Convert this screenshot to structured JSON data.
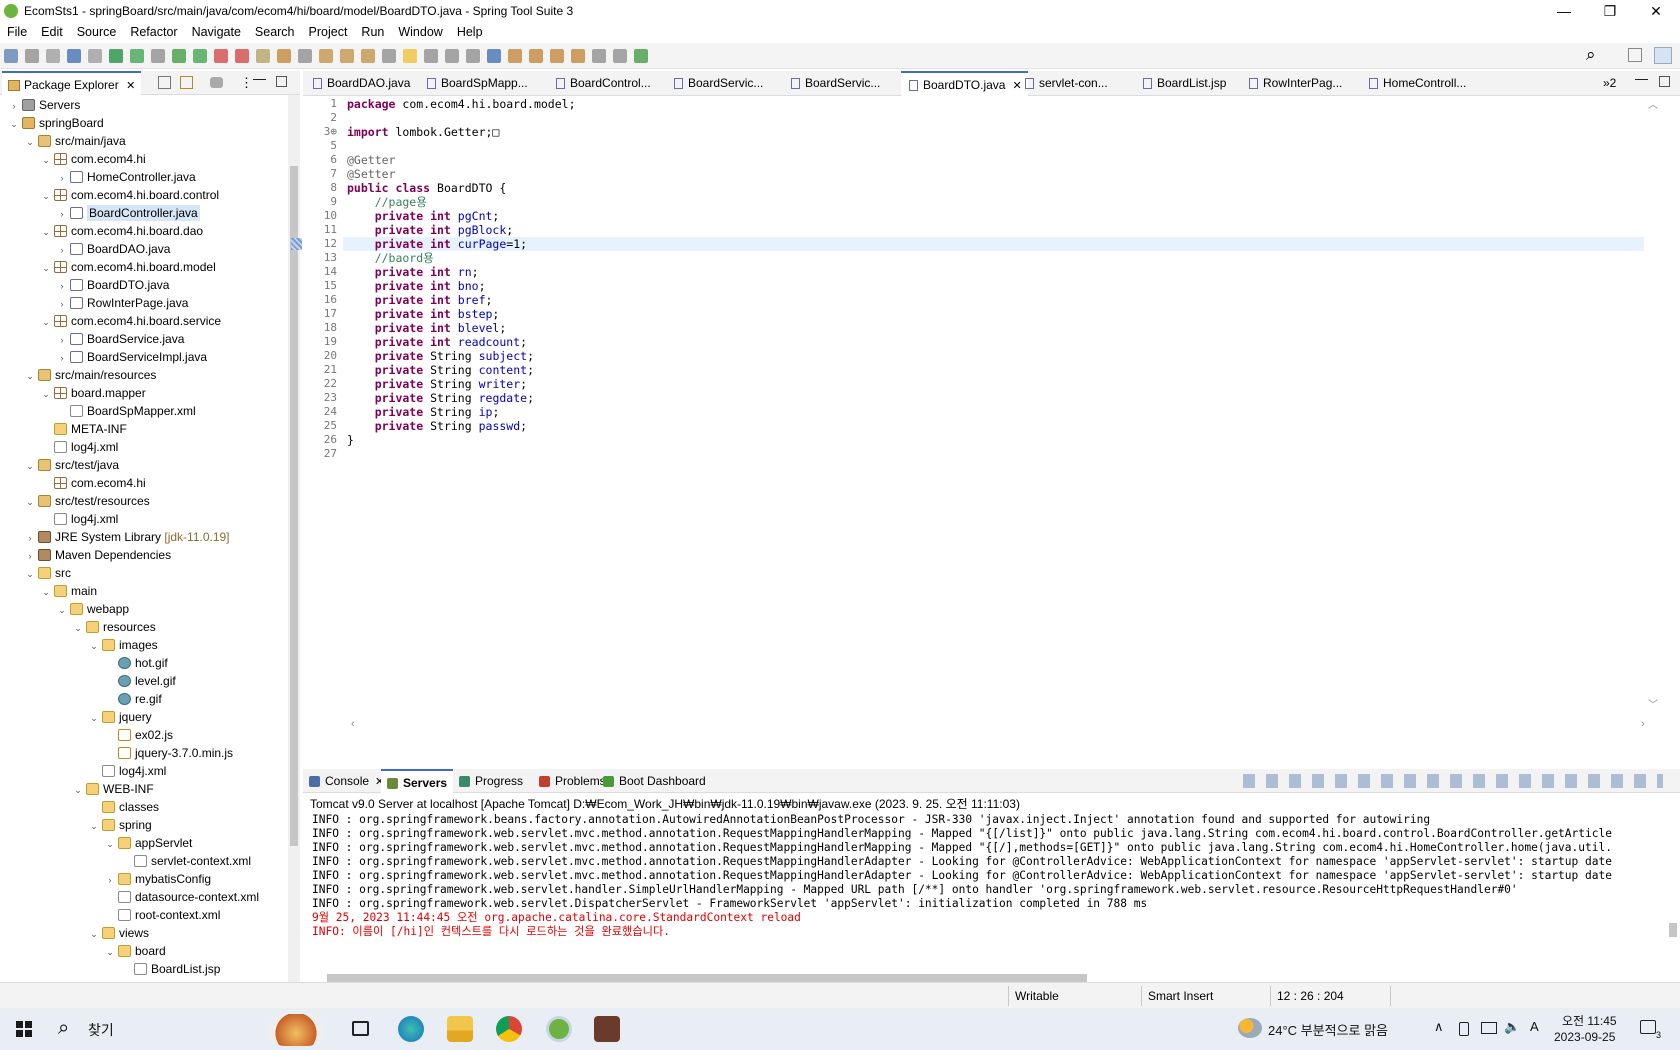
{
  "window": {
    "title": "EcomSts1 - springBoard/src/main/java/com/ecom4/hi/board/model/BoardDTO.java - Spring Tool Suite 3",
    "min_glyph": "—",
    "max_glyph": "❐",
    "close_glyph": "✕"
  },
  "menu": [
    "File",
    "Edit",
    "Source",
    "Refactor",
    "Navigate",
    "Search",
    "Project",
    "Run",
    "Window",
    "Help"
  ],
  "package_explorer": {
    "tab_label": "Package Explorer",
    "close_glyph": "✕",
    "tree": [
      {
        "label": "Servers",
        "level": 0,
        "twisty": "›",
        "icon": "srv"
      },
      {
        "label": "springBoard",
        "level": 0,
        "twisty": "⌄",
        "icon": "proj"
      },
      {
        "label": "src/main/java",
        "level": 1,
        "twisty": "⌄",
        "icon": "src"
      },
      {
        "label": "com.ecom4.hi",
        "level": 2,
        "twisty": "⌄",
        "icon": "pkg"
      },
      {
        "label": "HomeController.java",
        "level": 3,
        "twisty": "›",
        "icon": "java"
      },
      {
        "label": "com.ecom4.hi.board.control",
        "level": 2,
        "twisty": "⌄",
        "icon": "pkg"
      },
      {
        "label": "BoardController.java",
        "level": 3,
        "twisty": "›",
        "icon": "java",
        "selected": true
      },
      {
        "label": "com.ecom4.hi.board.dao",
        "level": 2,
        "twisty": "⌄",
        "icon": "pkg"
      },
      {
        "label": "BoardDAO.java",
        "level": 3,
        "twisty": "›",
        "icon": "java"
      },
      {
        "label": "com.ecom4.hi.board.model",
        "level": 2,
        "twisty": "⌄",
        "icon": "pkg"
      },
      {
        "label": "BoardDTO.java",
        "level": 3,
        "twisty": "›",
        "icon": "java"
      },
      {
        "label": "RowInterPage.java",
        "level": 3,
        "twisty": "›",
        "icon": "java"
      },
      {
        "label": "com.ecom4.hi.board.service",
        "level": 2,
        "twisty": "⌄",
        "icon": "pkg"
      },
      {
        "label": "BoardService.java",
        "level": 3,
        "twisty": "›",
        "icon": "java"
      },
      {
        "label": "BoardServiceImpl.java",
        "level": 3,
        "twisty": "›",
        "icon": "java"
      },
      {
        "label": "src/main/resources",
        "level": 1,
        "twisty": "⌄",
        "icon": "src"
      },
      {
        "label": "board.mapper",
        "level": 2,
        "twisty": "⌄",
        "icon": "pkg"
      },
      {
        "label": "BoardSpMapper.xml",
        "level": 3,
        "twisty": "",
        "icon": "xml"
      },
      {
        "label": "META-INF",
        "level": 2,
        "twisty": "",
        "icon": "fold"
      },
      {
        "label": "log4j.xml",
        "level": 2,
        "twisty": "",
        "icon": "xml"
      },
      {
        "label": "src/test/java",
        "level": 1,
        "twisty": "⌄",
        "icon": "src"
      },
      {
        "label": "com.ecom4.hi",
        "level": 2,
        "twisty": "",
        "icon": "pkg"
      },
      {
        "label": "src/test/resources",
        "level": 1,
        "twisty": "⌄",
        "icon": "src"
      },
      {
        "label": "log4j.xml",
        "level": 2,
        "twisty": "",
        "icon": "xml"
      },
      {
        "label": "JRE System Library",
        "suffix": "[jdk-11.0.19]",
        "level": 1,
        "twisty": "›",
        "icon": "lib"
      },
      {
        "label": "Maven Dependencies",
        "level": 1,
        "twisty": "›",
        "icon": "lib"
      },
      {
        "label": "src",
        "level": 1,
        "twisty": "⌄",
        "icon": "fold"
      },
      {
        "label": "main",
        "level": 2,
        "twisty": "⌄",
        "icon": "fold"
      },
      {
        "label": "webapp",
        "level": 3,
        "twisty": "⌄",
        "icon": "fold"
      },
      {
        "label": "resources",
        "level": 4,
        "twisty": "⌄",
        "icon": "fold"
      },
      {
        "label": "images",
        "level": 5,
        "twisty": "⌄",
        "icon": "fold"
      },
      {
        "label": "hot.gif",
        "level": 6,
        "twisty": "",
        "icon": "gif"
      },
      {
        "label": "level.gif",
        "level": 6,
        "twisty": "",
        "icon": "gif"
      },
      {
        "label": "re.gif",
        "level": 6,
        "twisty": "",
        "icon": "gif"
      },
      {
        "label": "jquery",
        "level": 5,
        "twisty": "⌄",
        "icon": "fold"
      },
      {
        "label": "ex02.js",
        "level": 6,
        "twisty": "",
        "icon": "js"
      },
      {
        "label": "jquery-3.7.0.min.js",
        "level": 6,
        "twisty": "",
        "icon": "js"
      },
      {
        "label": "log4j.xml",
        "level": 5,
        "twisty": "",
        "icon": "xml"
      },
      {
        "label": "WEB-INF",
        "level": 4,
        "twisty": "⌄",
        "icon": "fold"
      },
      {
        "label": "classes",
        "level": 5,
        "twisty": "",
        "icon": "fold"
      },
      {
        "label": "spring",
        "level": 5,
        "twisty": "⌄",
        "icon": "fold"
      },
      {
        "label": "appServlet",
        "level": 6,
        "twisty": "⌄",
        "icon": "fold"
      },
      {
        "label": "servlet-context.xml",
        "level": 7,
        "twisty": "",
        "icon": "xml"
      },
      {
        "label": "mybatisConfig",
        "level": 6,
        "twisty": "›",
        "icon": "fold"
      },
      {
        "label": "datasource-context.xml",
        "level": 6,
        "twisty": "",
        "icon": "xml"
      },
      {
        "label": "root-context.xml",
        "level": 6,
        "twisty": "",
        "icon": "xml"
      },
      {
        "label": "views",
        "level": 5,
        "twisty": "⌄",
        "icon": "fold"
      },
      {
        "label": "board",
        "level": 6,
        "twisty": "⌄",
        "icon": "fold"
      },
      {
        "label": "BoardList.jsp",
        "level": 7,
        "twisty": "",
        "icon": "xml"
      }
    ]
  },
  "editor": {
    "tabs": [
      {
        "label": "BoardDAO.java",
        "active": false
      },
      {
        "label": "BoardSpMapp...",
        "active": false
      },
      {
        "label": "BoardControl...",
        "active": false
      },
      {
        "label": "BoardServic...",
        "active": false
      },
      {
        "label": "BoardServic...",
        "active": false
      },
      {
        "label": "BoardDTO.java",
        "active": true
      },
      {
        "label": "servlet-con...",
        "active": false
      },
      {
        "label": "BoardList.jsp",
        "active": false
      },
      {
        "label": "RowInterPag...",
        "active": false
      },
      {
        "label": "HomeControll...",
        "active": false
      }
    ],
    "overflow_label": "»2",
    "lines": [
      {
        "n": "1",
        "code": [
          [
            "kw",
            "package"
          ],
          [
            "",
            "com.ecom4.hi.board.model;"
          ]
        ]
      },
      {
        "n": "2",
        "code": []
      },
      {
        "n": "3⊕",
        "code": [
          [
            "kw",
            "import"
          ],
          [
            "",
            "lombok.Getter;□"
          ]
        ]
      },
      {
        "n": "5",
        "code": []
      },
      {
        "n": "6",
        "code": [
          [
            "an",
            "@Getter"
          ]
        ]
      },
      {
        "n": "7",
        "code": [
          [
            "an",
            "@Setter"
          ]
        ]
      },
      {
        "n": "8",
        "code": [
          [
            "kw",
            "public class"
          ],
          [
            "",
            "BoardDTO {"
          ]
        ]
      },
      {
        "n": "9",
        "code": [
          [
            "cm",
            "    //page용"
          ]
        ]
      },
      {
        "n": "10",
        "code": [
          [
            "kw",
            "    private int"
          ],
          [
            "fd",
            "pgCnt"
          ],
          [
            "",
            ";"
          ]
        ]
      },
      {
        "n": "11",
        "code": [
          [
            "kw",
            "    private int"
          ],
          [
            "fd",
            "pgBlock"
          ],
          [
            "",
            ";"
          ]
        ]
      },
      {
        "n": "12",
        "code": [
          [
            "kw",
            "    private int"
          ],
          [
            "fd",
            "curPage"
          ],
          [
            "",
            "=1;"
          ]
        ],
        "current": true
      },
      {
        "n": "13",
        "code": [
          [
            "cm",
            "    //baord용"
          ]
        ]
      },
      {
        "n": "14",
        "code": [
          [
            "kw",
            "    private int"
          ],
          [
            "fd",
            "rn"
          ],
          [
            "",
            ";"
          ]
        ]
      },
      {
        "n": "15",
        "code": [
          [
            "kw",
            "    private int"
          ],
          [
            "fd",
            "bno"
          ],
          [
            "",
            ";"
          ]
        ]
      },
      {
        "n": "16",
        "code": [
          [
            "kw",
            "    private int"
          ],
          [
            "fd",
            "bref"
          ],
          [
            "",
            ";"
          ]
        ]
      },
      {
        "n": "17",
        "code": [
          [
            "kw",
            "    private int"
          ],
          [
            "fd",
            "bstep"
          ],
          [
            "",
            ";"
          ]
        ]
      },
      {
        "n": "18",
        "code": [
          [
            "kw",
            "    private int"
          ],
          [
            "fd",
            "blevel"
          ],
          [
            "",
            ";"
          ]
        ]
      },
      {
        "n": "19",
        "code": [
          [
            "kw",
            "    private int"
          ],
          [
            "fd",
            "readcount"
          ],
          [
            "",
            ";"
          ]
        ]
      },
      {
        "n": "20",
        "code": [
          [
            "kw",
            "    private"
          ],
          [
            "",
            "String"
          ],
          [
            "fd",
            "subject"
          ],
          [
            "",
            ";"
          ]
        ]
      },
      {
        "n": "21",
        "code": [
          [
            "kw",
            "    private"
          ],
          [
            "",
            "String"
          ],
          [
            "fd",
            "content"
          ],
          [
            "",
            ";"
          ]
        ]
      },
      {
        "n": "22",
        "code": [
          [
            "kw",
            "    private"
          ],
          [
            "",
            "String"
          ],
          [
            "fd",
            "writer"
          ],
          [
            "",
            ";"
          ]
        ]
      },
      {
        "n": "23",
        "code": [
          [
            "kw",
            "    private"
          ],
          [
            "",
            "String"
          ],
          [
            "fd",
            "regdate"
          ],
          [
            "",
            ";"
          ]
        ]
      },
      {
        "n": "24",
        "code": [
          [
            "kw",
            "    private"
          ],
          [
            "",
            "String"
          ],
          [
            "fd",
            "ip"
          ],
          [
            "",
            ";"
          ]
        ]
      },
      {
        "n": "25",
        "code": [
          [
            "kw",
            "    private"
          ],
          [
            "",
            "String"
          ],
          [
            "fd",
            "passwd"
          ],
          [
            "",
            ";"
          ]
        ]
      },
      {
        "n": "26",
        "code": [
          [
            "",
            "}"
          ]
        ]
      },
      {
        "n": "27",
        "code": []
      }
    ]
  },
  "console": {
    "tabs": [
      {
        "label": "Console",
        "active": false,
        "color": "#4a6fa5",
        "close": "✕"
      },
      {
        "label": "Servers",
        "active": true,
        "color": "#6a8a3a"
      },
      {
        "label": "Progress",
        "active": false,
        "color": "#3a8a6a"
      },
      {
        "label": "Problems",
        "active": false,
        "color": "#c04030"
      },
      {
        "label": "Boot Dashboard",
        "active": false,
        "color": "#4a9a3a"
      }
    ],
    "header": "Tomcat v9.0 Server at localhost [Apache Tomcat] D:₩Ecom_Work_JH₩bin₩jdk-11.0.19₩bin₩javaw.exe  (2023. 9. 25. 오전 11:11:03)",
    "lines": [
      {
        "text": "INFO : org.springframework.beans.factory.annotation.AutowiredAnnotationBeanPostProcessor - JSR-330 'javax.inject.Inject' annotation found and supported for autowiring",
        "red": false
      },
      {
        "text": "INFO : org.springframework.web.servlet.mvc.method.annotation.RequestMappingHandlerMapping - Mapped \"{[/list]}\" onto public java.lang.String com.ecom4.hi.board.control.BoardController.getArticle",
        "red": false
      },
      {
        "text": "INFO : org.springframework.web.servlet.mvc.method.annotation.RequestMappingHandlerMapping - Mapped \"{[/],methods=[GET]}\" onto public java.lang.String com.ecom4.hi.HomeController.home(java.util.",
        "red": false
      },
      {
        "text": "INFO : org.springframework.web.servlet.mvc.method.annotation.RequestMappingHandlerAdapter - Looking for @ControllerAdvice: WebApplicationContext for namespace 'appServlet-servlet': startup date",
        "red": false
      },
      {
        "text": "INFO : org.springframework.web.servlet.mvc.method.annotation.RequestMappingHandlerAdapter - Looking for @ControllerAdvice: WebApplicationContext for namespace 'appServlet-servlet': startup date",
        "red": false
      },
      {
        "text": "INFO : org.springframework.web.servlet.handler.SimpleUrlHandlerMapping - Mapped URL path [/**] onto handler 'org.springframework.web.servlet.resource.ResourceHttpRequestHandler#0'",
        "red": false
      },
      {
        "text": "INFO : org.springframework.web.servlet.DispatcherServlet - FrameworkServlet 'appServlet': initialization completed in 788 ms",
        "red": false
      },
      {
        "text": "9월 25, 2023 11:44:45 오전 org.apache.catalina.core.StandardContext reload",
        "red": true
      },
      {
        "text": "INFO: 이름이 [/hi]인 컨텍스트를 다시 로드하는 것을 완료했습니다.",
        "red": true
      }
    ]
  },
  "status": {
    "writable": "Writable",
    "insert_mode": "Smart Insert",
    "position": "12 : 26 : 204"
  },
  "taskbar": {
    "search_label": "찾기",
    "weather": "24°C  부분적으로 맑음",
    "time": "오전 11:45",
    "date": "2023-09-25",
    "ime": "A",
    "notif_count": "3",
    "search_icon": "⌕",
    "chevron": "∧",
    "vol": "🔈"
  },
  "colors": {
    "keyword": "#7f0055",
    "field": "#0000c0",
    "comment": "#3f7f5f",
    "active_tab": "#3b6dc3",
    "console_error": "#e00000"
  }
}
